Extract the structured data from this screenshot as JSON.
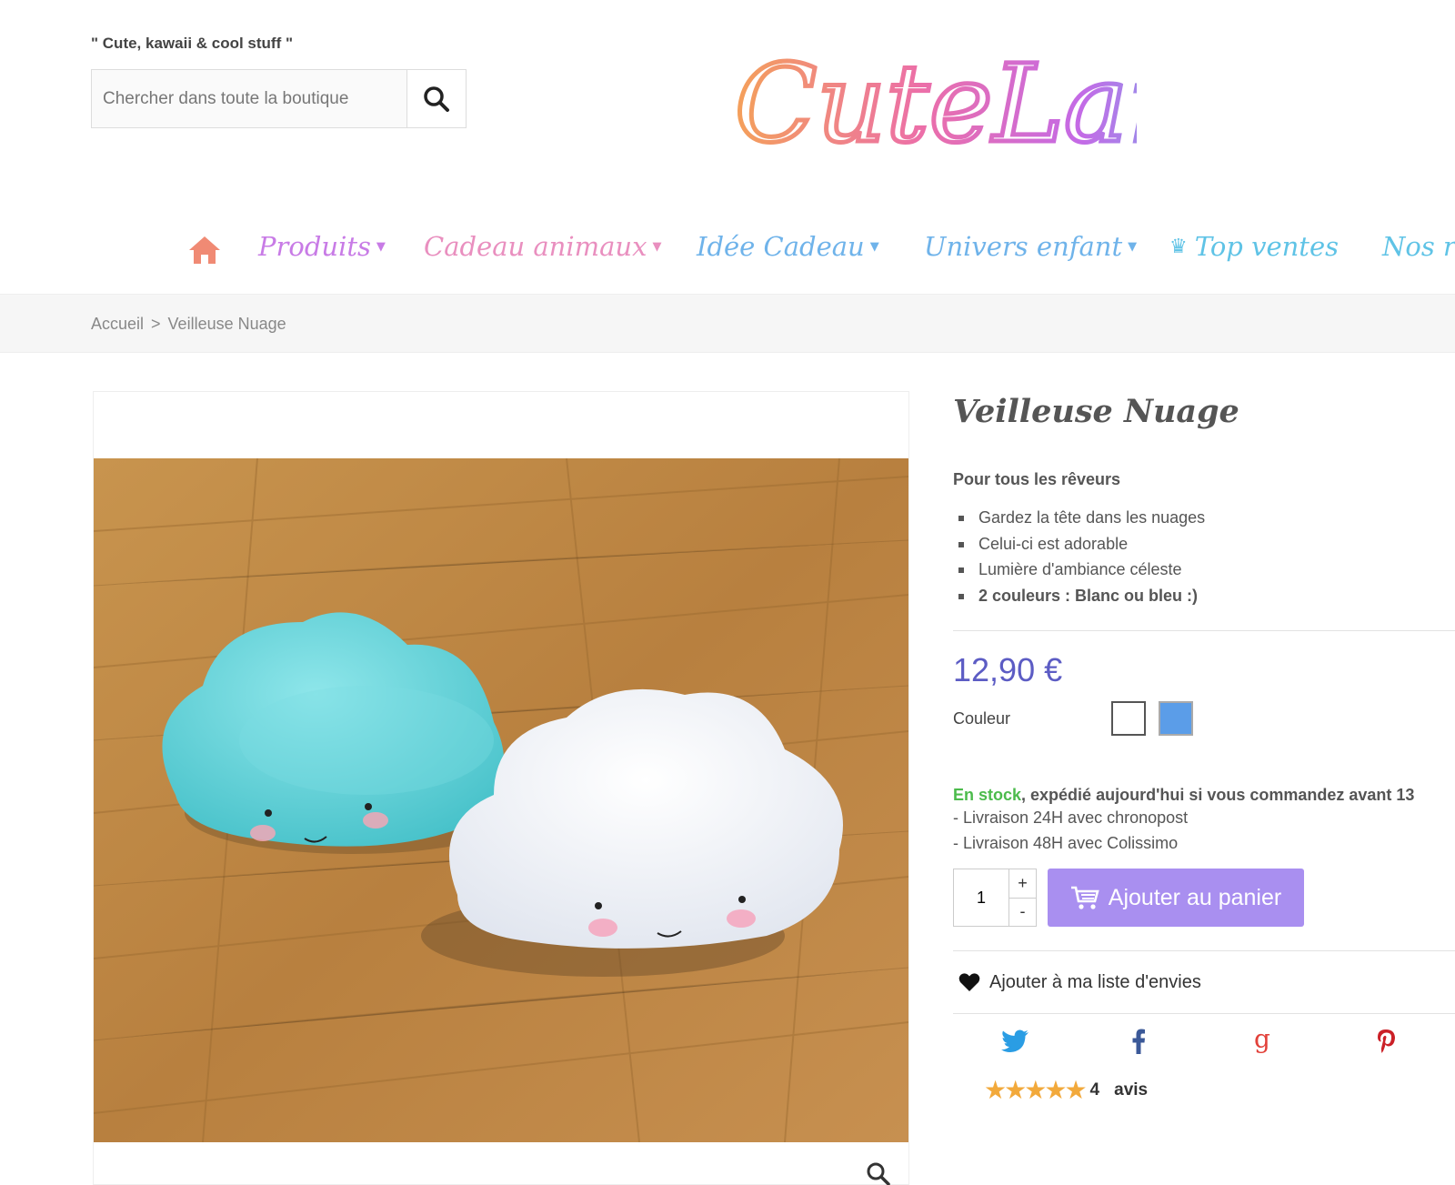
{
  "header": {
    "tagline": "\" Cute, kawaii & cool stuff \"",
    "search_placeholder": "Chercher dans toute la boutique",
    "logo_text": "CuteLand"
  },
  "nav": {
    "items": [
      {
        "label": "Produits",
        "color": "#c87be6",
        "has_dropdown": true
      },
      {
        "label": "Cadeau animaux",
        "color": "#e98fbf",
        "has_dropdown": true
      },
      {
        "label": "Idée Cadeau",
        "color": "#6fb3ea",
        "has_dropdown": true
      },
      {
        "label": "Univers enfant",
        "color": "#6fb3ea",
        "has_dropdown": true
      },
      {
        "label": "Top ventes",
        "color": "#5fc3e6",
        "has_dropdown": false,
        "icon": "crown-icon"
      },
      {
        "label": "Nos r",
        "color": "#5fc3e6",
        "has_dropdown": false
      }
    ],
    "home_color": "#f08a74"
  },
  "breadcrumb": {
    "home": "Accueil",
    "separator": ">",
    "current": "Veilleuse Nuage"
  },
  "product": {
    "title": "Veilleuse Nuage",
    "subtitle": "Pour tous les rêveurs",
    "features": [
      "Gardez la tête dans les nuages",
      "Celui-ci est adorable",
      "Lumière d'ambiance céleste",
      "2 couleurs : Blanc ou bleu :)"
    ],
    "price": "12,90 €",
    "color_label": "Couleur",
    "colors": [
      {
        "name": "Blanc",
        "hex": "#ffffff"
      },
      {
        "name": "Bleu",
        "hex": "#5b9de8"
      }
    ],
    "stock_status": "En stock",
    "stock_detail": ", expédié aujourd'hui si vous commandez avant 13",
    "shipping": [
      "- Livraison 24H avec chronopost",
      "- Livraison 48H avec Colissimo"
    ],
    "quantity": "1",
    "qty_plus": "+",
    "qty_minus": "-",
    "add_to_cart": "Ajouter au panier",
    "wishlist": "Ajouter à ma liste d'envies",
    "rating_stars": 5,
    "rating_count": "4",
    "rating_label": "avis"
  },
  "colors": {
    "price": "#5c5cc4",
    "add_to_cart_bg": "#a98ff0",
    "in_stock": "#4cbb4c",
    "twitter": "#2a9de4",
    "facebook": "#3b5998",
    "google": "#e2413a",
    "pinterest": "#cb2027",
    "star": "#f2a93b"
  }
}
